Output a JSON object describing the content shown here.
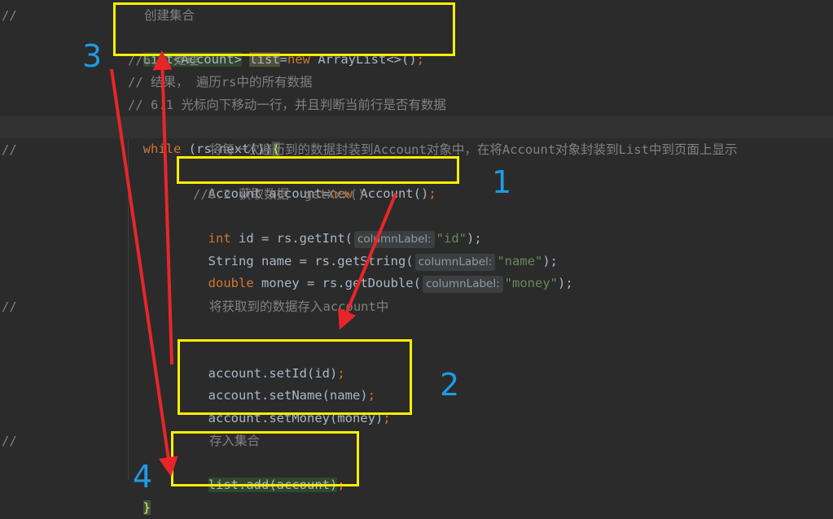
{
  "gutter_marks": {
    "m1": "//",
    "m2": "//",
    "m3": "//",
    "m4": "//"
  },
  "code": {
    "l1": "创建集合",
    "l2_type": "List<Account>",
    "l2_var": "list",
    "l2_eq": "=",
    "l2_new": "new",
    "l2_rest": " ArrayList<>()",
    "l2_semi": ";",
    "l3": "//6.2 处理",
    "l4": "// 结果， 遍历rs中的所有数据",
    "l5": "// 6.1 光标向下移动一行，并且判断当前行是否有数据",
    "l6_kw": "while",
    "l6_rest": " (rs.next())",
    "l6_brace": "{",
    "l7": "将每一次遍历到的数据封装到Account对象中，在将Account对象封装到List中到页面上显示",
    "l8_a": "Account account=",
    "l8_new": "new",
    "l8_b": " Account()",
    "l8_semi": ";",
    "l9": "//6.2 获取数据  getXxx()",
    "l10_kw": "int",
    "l10_a": " id = rs.getInt(",
    "l10_hint": "columnLabel:",
    "l10_str": "\"id\"",
    "l10_end": ");",
    "l11_a": "String name = rs.getString(",
    "l11_hint": "columnLabel:",
    "l11_str": "\"name\"",
    "l11_end": ");",
    "l12_kw": "double",
    "l12_a": " money = rs.getDouble(",
    "l12_hint": "columnLabel:",
    "l12_str": "\"money\"",
    "l12_end": ");",
    "l13": "将获取到的数据存入account中",
    "l14_a": "account.setId(id)",
    "l14_semi": ";",
    "l15_a": "account.setName(name)",
    "l15_semi": ";",
    "l16_a": "account.setMoney(money)",
    "l16_semi": ";",
    "l17": "存入集合",
    "l18_a": "list.add(account)",
    "l18_semi": ";",
    "l19": "}"
  },
  "annotations": {
    "n1": "1",
    "n2": "2",
    "n3": "3",
    "n4": "4"
  },
  "colors": {
    "box": "#ffee00",
    "arrow": "#e8262a",
    "number": "#1e9be6"
  }
}
